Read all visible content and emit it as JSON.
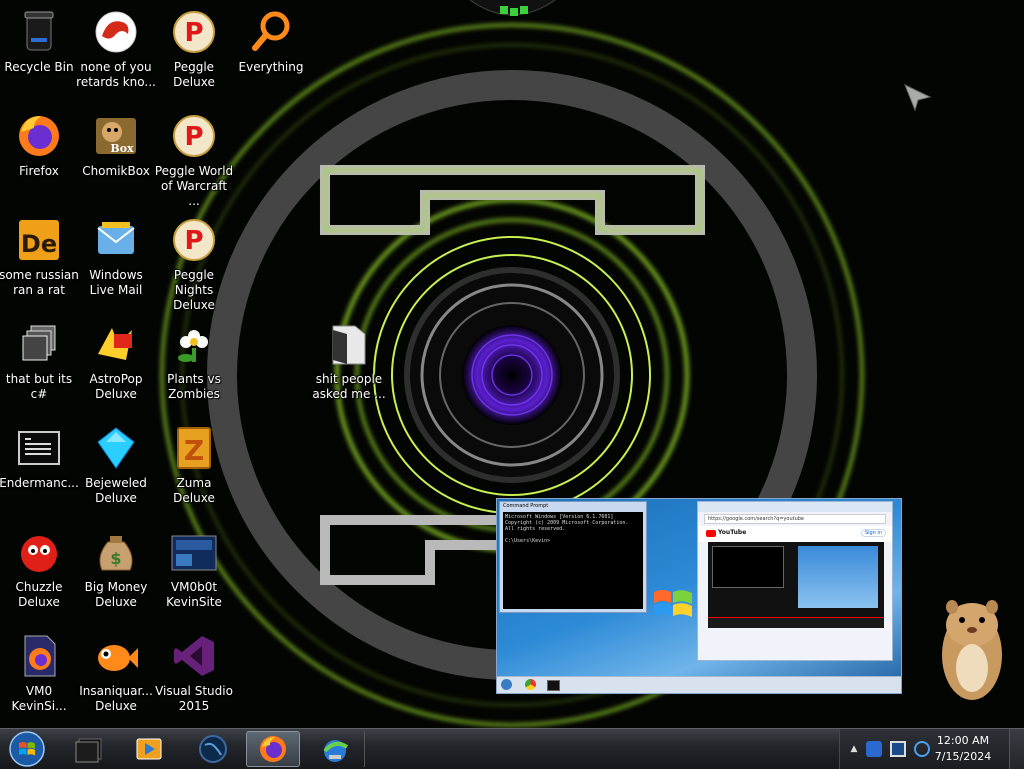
{
  "desktop_icons": [
    {
      "label": "Recycle Bin",
      "icon": "recycle-bin-icon"
    },
    {
      "label": "none of you retards kno...",
      "icon": "dragon-icon"
    },
    {
      "label": "Peggle Deluxe",
      "icon": "peggle-icon"
    },
    {
      "label": "Everything",
      "icon": "magnifier-icon"
    },
    {
      "label": "Firefox",
      "icon": "firefox-icon"
    },
    {
      "label": "ChomikBox",
      "icon": "hamster-box-icon"
    },
    {
      "label": "Peggle World of Warcraft ...",
      "icon": "peggle-icon"
    },
    {
      "label": "some russian ran a rat",
      "icon": "de-app-icon"
    },
    {
      "label": "Windows Live Mail",
      "icon": "mail-icon"
    },
    {
      "label": "Peggle Nights Deluxe",
      "icon": "peggle-icon"
    },
    {
      "label": "that but its c#",
      "icon": "windows-stack-icon"
    },
    {
      "label": "AstroPop Deluxe",
      "icon": "astropop-icon"
    },
    {
      "label": "Plants vs Zombies",
      "icon": "flower-icon"
    },
    {
      "label": "shit people asked me ...",
      "icon": "folder-icon"
    },
    {
      "label": "Endermanc...",
      "icon": "console-icon"
    },
    {
      "label": "Bejeweled Deluxe",
      "icon": "gem-icon"
    },
    {
      "label": "Zuma Deluxe",
      "icon": "zuma-icon"
    },
    {
      "label": "Chuzzle Deluxe",
      "icon": "chuzzle-icon"
    },
    {
      "label": "Big Money Deluxe",
      "icon": "money-bag-icon"
    },
    {
      "label": "VM0b0t KevinSite",
      "icon": "website-icon"
    },
    {
      "label": "VM0 KevinSi...",
      "icon": "firefox-doc-icon"
    },
    {
      "label": "Insaniquar... Deluxe",
      "icon": "fish-icon"
    },
    {
      "label": "Visual Studio 2015",
      "icon": "visual-studio-icon"
    }
  ],
  "preview": {
    "cmd_title": "Command Prompt",
    "cmd_lines": [
      "Microsoft Windows [Version 6.1.7601]",
      "Copyright (c) 2009 Microsoft Corporation.",
      "All rights reserved.",
      "",
      "C:\\Users\\Kevin>"
    ],
    "browser_url": "https://google.com/search?q=youtube",
    "yt_label": "YouTube",
    "signin_label": "Sign in"
  },
  "taskbar": {
    "items": [
      {
        "name": "start-button",
        "icon": "windows-orb-icon"
      },
      {
        "name": "taskbar-console",
        "icon": "console-icon"
      },
      {
        "name": "taskbar-media-player",
        "icon": "media-player-icon"
      },
      {
        "name": "taskbar-globe",
        "icon": "globe-icon"
      },
      {
        "name": "taskbar-firefox",
        "icon": "firefox-icon"
      },
      {
        "name": "taskbar-installer",
        "icon": "installer-icon"
      }
    ],
    "clock_time": "12:00 AM",
    "clock_date": "7/15/2024"
  },
  "colors": {
    "accent_green": "#9bdc2a",
    "accent_purple": "#5a1fd0",
    "taskbar": "#1e2125"
  }
}
